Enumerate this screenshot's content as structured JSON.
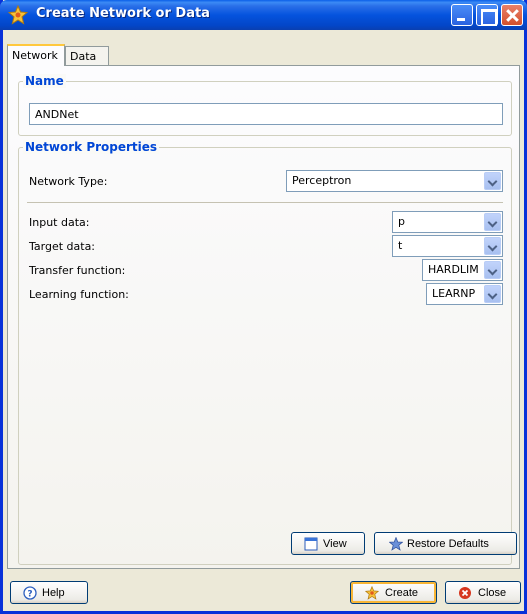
{
  "window": {
    "title": "Create Network or Data"
  },
  "tabs": [
    {
      "label": "Network"
    },
    {
      "label": "Data"
    }
  ],
  "name_group": {
    "legend": "Name",
    "value": "ANDNet"
  },
  "props_group": {
    "legend": "Network Properties",
    "network_type": {
      "label": "Network Type:",
      "value": "Perceptron"
    },
    "input_data": {
      "label": "Input data:",
      "value": "p"
    },
    "target_data": {
      "label": "Target data:",
      "value": "t"
    },
    "transfer_function": {
      "label": "Transfer function:",
      "value": "HARDLIM"
    },
    "learning_function": {
      "label": "Learning function:",
      "value": "LEARNP"
    },
    "view_label": "View",
    "restore_label": "Restore Defaults"
  },
  "footer": {
    "help_label": "Help",
    "create_label": "Create",
    "close_label": "Close"
  },
  "colors": {
    "title_bar": "#0553DE",
    "legend": "#0046D5",
    "dialog_bg": "#ECE9D8"
  },
  "icons": {
    "title": "network-star-icon",
    "view": "window-icon",
    "restore": "star-icon",
    "help": "help-icon",
    "create": "network-star-icon",
    "close": "close-circle-icon"
  }
}
